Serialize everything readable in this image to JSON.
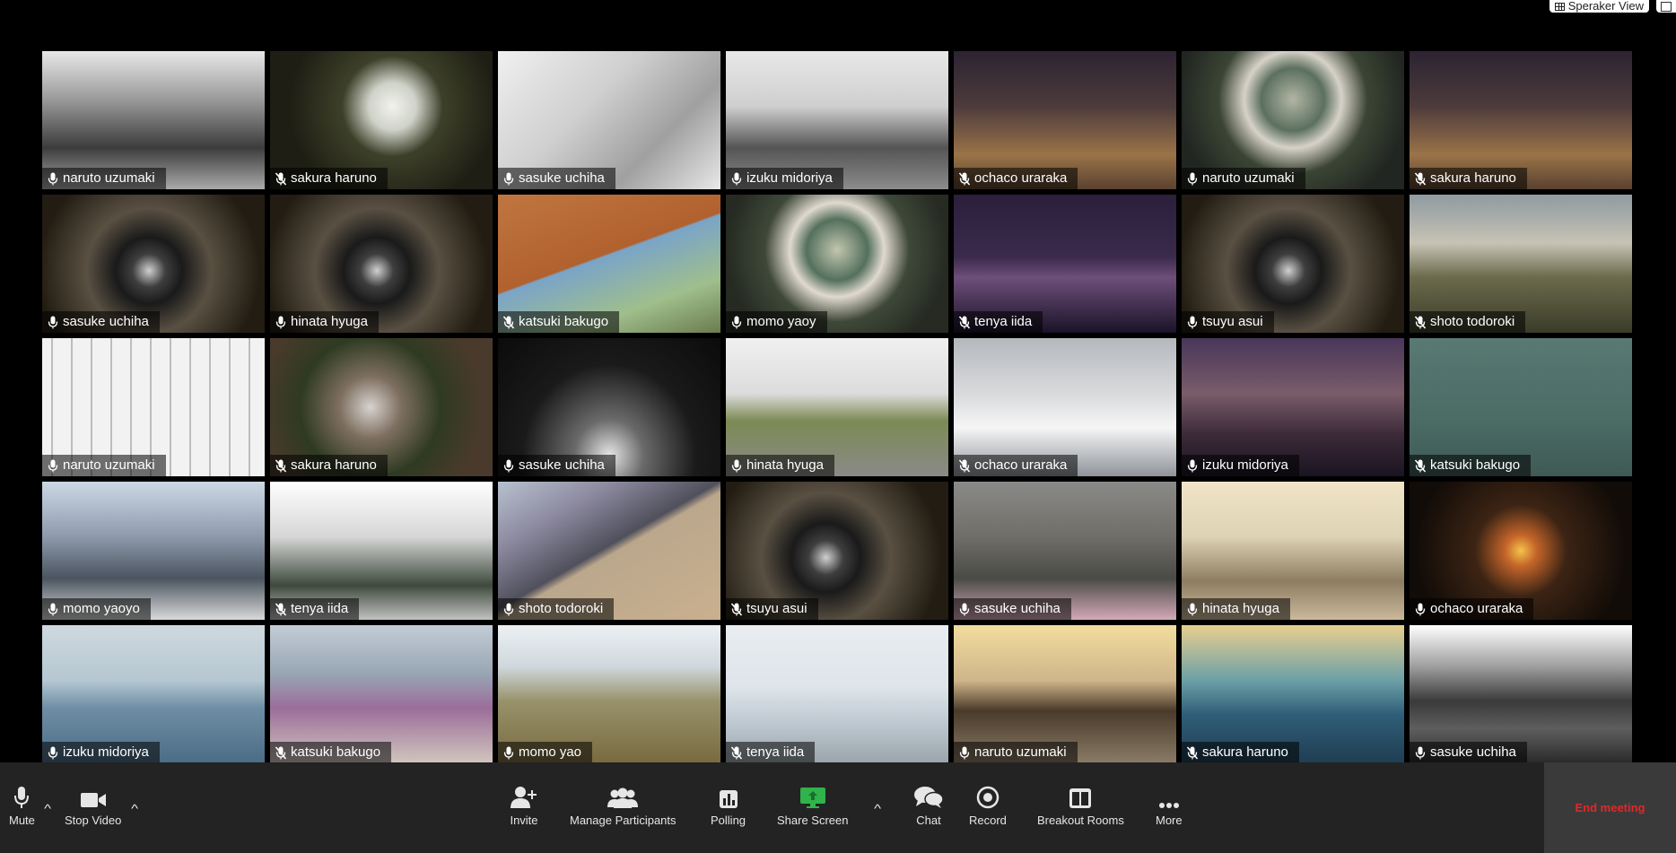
{
  "top": {
    "view_label": "Speraker View"
  },
  "participants": [
    {
      "name": "naruto uzumaki",
      "muted": false,
      "bg": "linear-gradient(180deg,#e8e8e8 0%,#9a9a9a 35%,#3c3c3c 70%,#aaaaaa 100%)"
    },
    {
      "name": "sakura haruno",
      "muted": true,
      "bg": "radial-gradient(circle at 55% 40%,#f2f2ee 0%,#cfd2c8 16%,#3d4029 34%,#1e1e14 70%)"
    },
    {
      "name": "sasuke uchiha",
      "muted": false,
      "bg": "linear-gradient(135deg,#f0f0f0 0%,#cfcfcf 40%,#a0a0a0 70%,#e8e8e8 100%)"
    },
    {
      "name": "izuku midoriya",
      "muted": false,
      "bg": "linear-gradient(180deg,#e8e8e8 0%,#cfcfcf 40%,#545454 70%,#8c8c8c 100%)"
    },
    {
      "name": "ochaco uraraka",
      "muted": true,
      "bg": "linear-gradient(180deg,#2c2332 0%,#4d3b3c 40%,#9a7348 75%,#5a4230 100%)"
    },
    {
      "name": "naruto uzumaki",
      "muted": false,
      "bg": "radial-gradient(circle at 50% 35%,#b2b6a4 0%,#5c7060 22%,#d7d2c8 34%,#3b4534 52%,#222622 80%)"
    },
    {
      "name": "sakura haruno",
      "muted": true,
      "bg": "linear-gradient(180deg,#2c2332 0%,#4d3b3c 40%,#9a7348 75%,#5a4230 100%)"
    },
    {
      "name": "sasuke uchiha",
      "muted": false,
      "bg": "radial-gradient(circle at 48% 55%,#d0d0d0 0%,#3e3e3e 12%,#1a1a1a 24%,#595042 45%,#221c12 80%)"
    },
    {
      "name": "hinata hyuga",
      "muted": false,
      "bg": "radial-gradient(circle at 48% 55%,#d0d0d0 0%,#3e3e3e 12%,#1a1a1a 24%,#595042 45%,#221c12 80%)"
    },
    {
      "name": "katsuki bakugo",
      "muted": true,
      "bg": "linear-gradient(160deg,#c07640 0%,#b1612e 45%,#7aa4c8 46%,#9fbf8c 75%,#6b7b4e 100%)"
    },
    {
      "name": "momo yaoy",
      "muted": false,
      "bg": "radial-gradient(circle at 50% 40%,#c2c6b0 0%,#54705c 22%,#e0d9cf 34%,#3e4838 52%,#262a22 80%)"
    },
    {
      "name": "tenya iida",
      "muted": true,
      "bg": "linear-gradient(180deg,#2b1f3b 0%,#3a2a4c 45%,#6e4e7a 60%,#1a1328 100%)"
    },
    {
      "name": "tsuyu asui",
      "muted": false,
      "bg": "radial-gradient(circle at 48% 55%,#d0d0d0 0%,#3e3e3e 12%,#1a1a1a 24%,#595042 45%,#221c12 80%)"
    },
    {
      "name": "shoto todoroki",
      "muted": true,
      "bg": "linear-gradient(180deg,#8f9aa1 0%,#c6c3b4 35%,#6b6a4c 60%,#3a3c28 100%)"
    },
    {
      "name": "naruto uzumaki",
      "muted": false,
      "bg": "repeating-linear-gradient(90deg,#f2f2f2 0 10px,#bdbdbd 10px 12px,#f2f2f2 12px 22px)"
    },
    {
      "name": "sakura haruno",
      "muted": true,
      "bg": "radial-gradient(circle at 45% 50%,#d7d3cf 0%,#7e6f60 22%,#2f3a22 50%,#4a3a2c 80%)"
    },
    {
      "name": "sasuke uchiha",
      "muted": false,
      "bg": "radial-gradient(ellipse at 50% 85%,#e6e6e6 0%,#6a6a6a 22%,#1a1a1a 55%,#0b0b0b 100%)"
    },
    {
      "name": "hinata hyuga",
      "muted": false,
      "bg": "linear-gradient(180deg,#f0f0f0 0%,#dcdcdc 40%,#7c8a54 60%,#8a8a88 100%)"
    },
    {
      "name": "ochaco uraraka",
      "muted": true,
      "bg": "linear-gradient(180deg,#b4b8bd 0%,#d9dadc 40%,#f5f5f5 65%,#8f939a 100%)"
    },
    {
      "name": "izuku midoriya",
      "muted": false,
      "bg": "linear-gradient(180deg,#49365a 0%,#7a5c6a 40%,#3c2a38 70%,#1b1422 100%)"
    },
    {
      "name": "katsuki bakugo",
      "muted": true,
      "bg": "linear-gradient(180deg,#587a73 0%,#4b6b65 60%,#3e5a55 100%)"
    },
    {
      "name": "momo yaoyo",
      "muted": false,
      "bg": "linear-gradient(180deg,#cdd8e6 0%,#8e99ac 40%,#4a5560 70%,#d9d9d9 100%)"
    },
    {
      "name": "tenya iida",
      "muted": true,
      "bg": "linear-gradient(180deg,#ffffff 0%,#d6d6d6 40%,#3e4a3c 75%,#c2c2c2 100%)"
    },
    {
      "name": "shoto todoroki",
      "muted": false,
      "bg": "linear-gradient(150deg,#b7c1ce 0%,#8d8aa0 25%,#50505c 48%,#bba78c 52%,#c9b08e 100%)"
    },
    {
      "name": "tsuyu asui",
      "muted": true,
      "bg": "radial-gradient(circle at 45% 55%,#d0d0d0 0%,#3e3e3e 12%,#1a1a1a 24%,#595042 45%,#221c12 80%)"
    },
    {
      "name": "sasuke uchiha",
      "muted": false,
      "bg": "linear-gradient(180deg,#8a8a88 0%,#6f6e68 40%,#4a4a46 70%,#d4a9b8 100%)"
    },
    {
      "name": "hinata hyuga",
      "muted": false,
      "bg": "linear-gradient(180deg,#f2e5c7 0%,#ddd2b4 40%,#8d7d62 72%,#cbb89a 100%)"
    },
    {
      "name": "ochaco uraraka",
      "muted": false,
      "bg": "radial-gradient(circle at 50% 50%,#f6c24a 0%,#c4652a 12%,#3c2414 35%,#120c08 80%)"
    },
    {
      "name": "izuku midoriya",
      "muted": false,
      "bg": "linear-gradient(180deg,#cfd9df 0%,#b5c7d2 40%,#6e8ea4 60%,#4a6c85 100%)"
    },
    {
      "name": "katsuki bakugo",
      "muted": true,
      "bg": "linear-gradient(180deg,#c3ccd6 0%,#98a6b4 35%,#9b6d9a 60%,#d0c6bd 100%)"
    },
    {
      "name": "momo yao",
      "muted": false,
      "bg": "linear-gradient(180deg,#ecf0f3 0%,#cfd8dd 30%,#98926a 55%,#786a40 100%)"
    },
    {
      "name": "tenya iida",
      "muted": true,
      "bg": "linear-gradient(180deg,#e9edf1 0%,#dee4ea 45%,#bfc9d2 70%,#9aa4aa 100%)"
    },
    {
      "name": "naruto uzumaki",
      "muted": false,
      "bg": "linear-gradient(180deg,#f2dd9e 0%,#cfb58a 40%,#4a3a2a 62%,#8a7c68 100%)"
    },
    {
      "name": "sakura haruno",
      "muted": true,
      "bg": "linear-gradient(180deg,#e8cf8f 0%,#6ca0a6 40%,#2f5d78 65%,#1f3e52 100%)"
    },
    {
      "name": "sasuke uchiha",
      "muted": false,
      "bg": "linear-gradient(180deg,#ffffff 0%,#9e9e9e 30%,#3a3a3a 55%,#5e5e5e 75%,#2a2a2a 100%)"
    }
  ],
  "toolbar": {
    "mute": "Mute",
    "stop_video": "Stop Video",
    "invite": "Invite",
    "manage_participants": "Manage Participants",
    "polling": "Polling",
    "share_screen": "Share Screen",
    "chat": "Chat",
    "record": "Record",
    "breakout_rooms": "Breakout Rooms",
    "more": "More",
    "end_meeting": "End meeting",
    "share_color": "#2fb34a",
    "end_color": "#e02828"
  }
}
